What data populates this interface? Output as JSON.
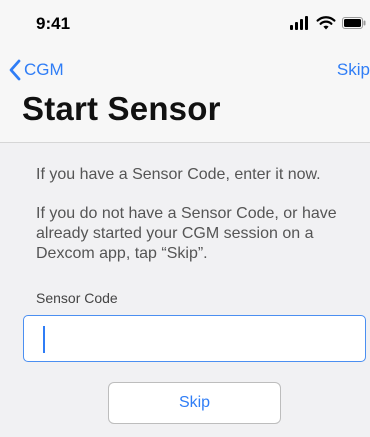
{
  "status_bar": {
    "time": "9:41",
    "icons": [
      "signal-icon",
      "wifi-icon",
      "battery-icon"
    ]
  },
  "nav": {
    "back_label": "CGM",
    "back_icon": "chevron-left-icon",
    "skip_label": "Skip"
  },
  "page": {
    "title": "Start Sensor"
  },
  "content": {
    "instruction_1": "If you have a Sensor Code, enter it now.",
    "instruction_2": "If you do not have a Sensor Code, or have already started your CGM session on a Dexcom app, tap “Skip”.",
    "field_label": "Sensor Code",
    "field_value": "",
    "skip_button_label": "Skip"
  },
  "colors": {
    "accent": "#2f7df6",
    "background": "#f7f7f7",
    "content_background": "#f1f1f3",
    "field_border": "#4b8ff1"
  }
}
